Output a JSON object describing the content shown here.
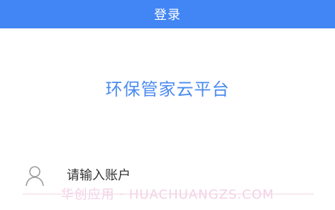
{
  "topbar": {
    "title": "登录"
  },
  "main": {
    "platform_title": "环保管家云平台"
  },
  "account": {
    "icon": "user-icon",
    "placeholder": "请输入账户",
    "value": ""
  },
  "watermark": {
    "text": "华创应用 · HUACHUANGZS.COM"
  },
  "colors": {
    "primary": "#4285f4",
    "title_blue": "#4a8bf0",
    "watermark_pink": "#f2d2e4"
  }
}
